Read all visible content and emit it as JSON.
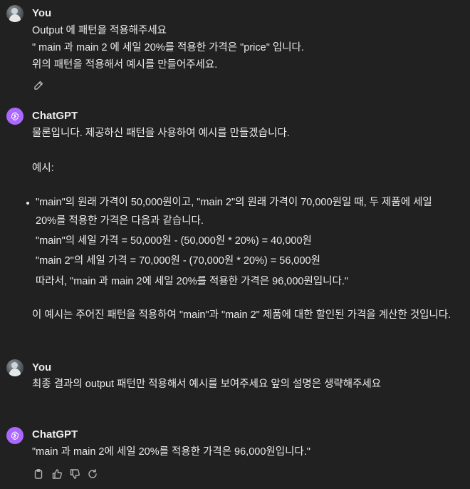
{
  "messages": [
    {
      "author": "You",
      "lines": [
        "Output 에 패턴을 적용해주세요",
        "\" main 과 main 2 에 세일 20%를 적용한 가격은 \"price\" 입니다.",
        "위의 패턴을 적용해서 예시를 만들어주세요."
      ]
    },
    {
      "author": "ChatGPT",
      "intro": "물론입니다. 제공하신 패턴을 사용하여 예시를 만들겠습니다.",
      "example_label": "예시:",
      "bullet_lines": [
        "\"main\"의 원래 가격이 50,000원이고, \"main 2\"의 원래 가격이 70,000원일 때, 두 제품에 세일",
        "20%를 적용한 가격은 다음과 같습니다.",
        "\"main\"의 세일 가격 = 50,000원 - (50,000원 * 20%) = 40,000원",
        "\"main 2\"의 세일 가격 = 70,000원 - (70,000원 * 20%) = 56,000원",
        "따라서, \"main 과 main 2에 세일 20%를 적용한 가격은 96,000원입니다.\""
      ],
      "outro": "이 예시는 주어진 패턴을 적용하여 \"main\"과 \"main 2\" 제품에 대한 할인된 가격을 계산한 것입니다."
    },
    {
      "author": "You",
      "lines": [
        "최종 결과의 output 패턴만 적용해서 예시를 보여주세요 앞의 설명은 생략해주세요"
      ]
    },
    {
      "author": "ChatGPT",
      "lines": [
        "\"main 과 main 2에 세일 20%를 적용한 가격은 96,000원입니다.\""
      ]
    }
  ],
  "icons": {
    "edit": "pencil-icon",
    "copy": "clipboard-icon",
    "like": "thumbs-up-icon",
    "dislike": "thumbs-down-icon",
    "regenerate": "refresh-icon"
  }
}
